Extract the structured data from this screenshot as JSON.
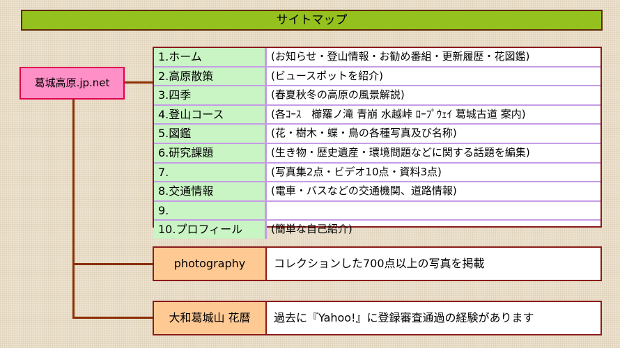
{
  "title": "サイトマップ",
  "root": "葛城高原.jp.net",
  "menu": [
    {
      "label": "1.ホーム",
      "desc": "(お知らせ・登山情報・お勧め番組・更新履歴・花図鑑)"
    },
    {
      "label": "2.高原散策",
      "desc": "(ビュースポットを紹介)"
    },
    {
      "label": "3.四季",
      "desc": "(春夏秋冬の高原の風景解説)"
    },
    {
      "label": "4.登山コース",
      "desc": "(各ｺｰｽ　櫛羅ノ滝 青崩 水越峠 ﾛｰﾌﾟｳｪｲ 葛城古道 案内)"
    },
    {
      "label": "5.図鑑",
      "desc": "(花・樹木・蝶・鳥の各種写真及び名称)"
    },
    {
      "label": "6.研究課題",
      "desc": "(生き物・歴史遺産・環境問題などに関する話題を編集)"
    },
    {
      "label": "7.",
      "desc": "(写真集2点・ビデオ10点・資料3点)"
    },
    {
      "label": "8.交通情報",
      "desc": "(電車・バスなどの交通機関、道路情報)"
    },
    {
      "label": "9.",
      "desc": ""
    },
    {
      "label": "10.プロフィール",
      "desc": "(簡単な自己紹介)"
    }
  ],
  "photography": {
    "label": "photography",
    "desc": "コレクションした700点以上の写真を掲載"
  },
  "hanagoyomi": {
    "label": "大和葛城山 花暦",
    "desc": "過去に『Yahoo!』に登録審査通過の経験があります"
  }
}
